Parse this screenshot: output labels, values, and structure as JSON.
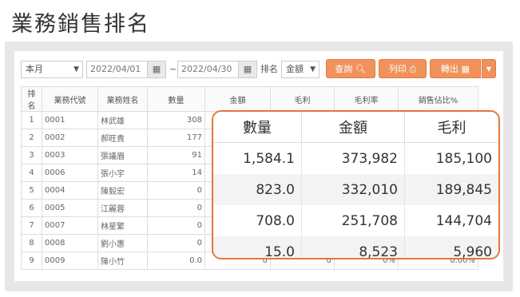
{
  "page_title": "業務銷售排名",
  "toolbar": {
    "period_value": "本月",
    "date_from": "2022/04/01",
    "date_sep": "~",
    "date_to": "2022/04/30",
    "rank_label": "排名",
    "rank_by_value": "金額",
    "query_label": "查詢",
    "print_label": "列印",
    "export_label": "轉出",
    "colors": {
      "accent": "#f0925a"
    }
  },
  "table": {
    "headers": [
      "排名",
      "業務代號",
      "業務姓名",
      "數量",
      "金額",
      "毛利",
      "毛利率",
      "銷售佔比%"
    ],
    "rows": [
      [
        "1",
        "0001",
        "林武雄",
        "308",
        "",
        "",
        "",
        ""
      ],
      [
        "2",
        "0002",
        "郝旺貴",
        "177",
        "",
        "",
        "",
        ""
      ],
      [
        "3",
        "0003",
        "張議眉",
        "91",
        "",
        "",
        "",
        ""
      ],
      [
        "4",
        "0006",
        "張小宇",
        "14",
        "",
        "",
        "",
        ""
      ],
      [
        "5",
        "0004",
        "陳毅宏",
        "0",
        "",
        "",
        "",
        ""
      ],
      [
        "6",
        "0005",
        "江麗蓉",
        "0",
        "",
        "",
        "",
        ""
      ],
      [
        "7",
        "0007",
        "林星繁",
        "0",
        "",
        "",
        "",
        ""
      ],
      [
        "8",
        "0008",
        "劉小惠",
        "0",
        "",
        "",
        "",
        ""
      ],
      [
        "9",
        "0009",
        "陳小竹",
        "0.0",
        "0",
        "0",
        "0%",
        "0.00%"
      ]
    ]
  },
  "callout": {
    "headers": [
      "數量",
      "金額",
      "毛利"
    ],
    "rows": [
      [
        "1,584.1",
        "373,982",
        "185,100"
      ],
      [
        "823.0",
        "332,010",
        "189,845"
      ],
      [
        "708.0",
        "251,708",
        "144,704"
      ],
      [
        "15.0",
        "8,523",
        "5,960"
      ]
    ]
  }
}
